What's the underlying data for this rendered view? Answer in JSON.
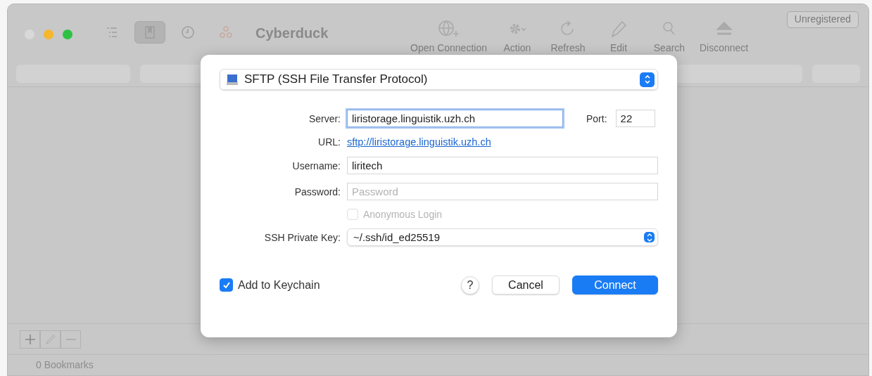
{
  "window": {
    "title": "Cyberduck",
    "badge": "Unregistered"
  },
  "view_toggles": [
    {
      "kind": "outline",
      "selected": false
    },
    {
      "kind": "bookmarks",
      "selected": true
    },
    {
      "kind": "history",
      "selected": false
    },
    {
      "kind": "bonjour",
      "selected": false
    }
  ],
  "toolbar": [
    {
      "kind": "globe",
      "label": "Open Connection"
    },
    {
      "kind": "gear",
      "label": "Action"
    },
    {
      "kind": "refresh",
      "label": "Refresh"
    },
    {
      "kind": "pencil",
      "label": "Edit"
    },
    {
      "kind": "search",
      "label": "Search"
    },
    {
      "kind": "eject",
      "label": "Disconnect"
    }
  ],
  "status_bar": "0 Bookmarks",
  "dialog": {
    "protocol": "SFTP (SSH File Transfer Protocol)",
    "server": {
      "label": "Server:",
      "value": "liristorage.linguistik.uzh.ch"
    },
    "port": {
      "label": "Port:",
      "value": "22"
    },
    "url": {
      "label": "URL:",
      "link": "sftp://liristorage.linguistik.uzh.ch"
    },
    "username": {
      "label": "Username:",
      "value": "liritech"
    },
    "password": {
      "label": "Password:",
      "placeholder": "Password"
    },
    "anonymous": {
      "label": "Anonymous Login",
      "checked": false,
      "disabled": true
    },
    "ssh_key": {
      "label": "SSH Private Key:",
      "value": "~/.ssh/id_ed25519"
    },
    "keychain": {
      "label": "Add to Keychain",
      "checked": true
    },
    "help": "?",
    "buttons": [
      {
        "kind": "cancel",
        "label": "Cancel"
      },
      {
        "kind": "default",
        "label": "Connect"
      }
    ]
  }
}
